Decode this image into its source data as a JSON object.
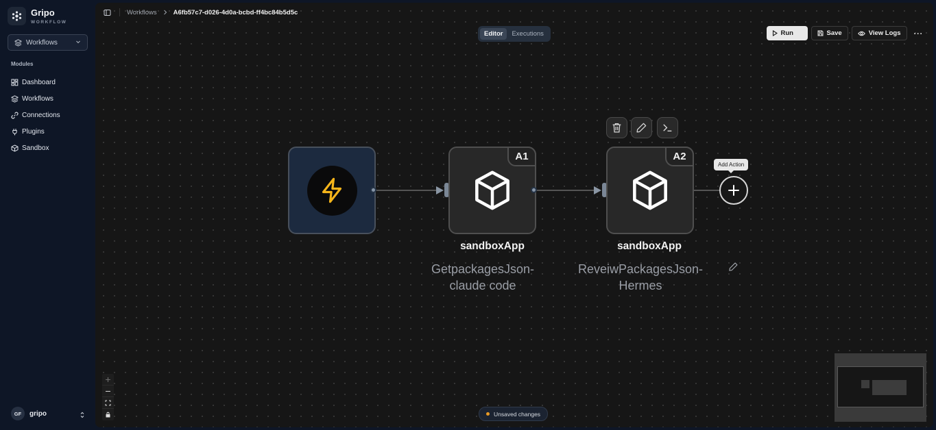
{
  "brand": {
    "name": "Gripo",
    "subtitle": "WORKFLOW"
  },
  "workspace_select": {
    "value": "Workflows"
  },
  "sidebar": {
    "section_label": "Modules",
    "items": [
      {
        "label": "Dashboard",
        "icon": "dashboard-icon"
      },
      {
        "label": "Workflows",
        "icon": "layers-icon"
      },
      {
        "label": "Connections",
        "icon": "link-icon"
      },
      {
        "label": "Plugins",
        "icon": "plug-icon"
      },
      {
        "label": "Sandbox",
        "icon": "box-icon"
      }
    ]
  },
  "user": {
    "initials": "GF",
    "name": "gripo"
  },
  "breadcrumb": {
    "parent": "Workflows",
    "current": "A6fb57c7-d026-4d0a-bcbd-ff4bc84b5d5c"
  },
  "tabs": [
    {
      "label": "Editor",
      "active": true
    },
    {
      "label": "Executions",
      "active": false
    }
  ],
  "toolbar": {
    "run_label": "Run",
    "save_label": "Save",
    "logs_label": "View Logs",
    "more_label": "···"
  },
  "nodes": {
    "trigger": {
      "icon": "lightning-icon",
      "accent": "#f5b51b"
    },
    "action1": {
      "badge": "A1",
      "title": "sandboxApp",
      "description": "GetpackagesJson-\nclaude code"
    },
    "action2": {
      "badge": "A2",
      "title": "sandboxApp",
      "description": "ReveiwPackagesJson-\nHermes"
    }
  },
  "add_action": {
    "tooltip": "Add Action"
  },
  "status": {
    "unsaved": "Unsaved changes",
    "dot_color": "#e89a25"
  },
  "zoom_controls": [
    "+",
    "−",
    "fit",
    "lock"
  ]
}
